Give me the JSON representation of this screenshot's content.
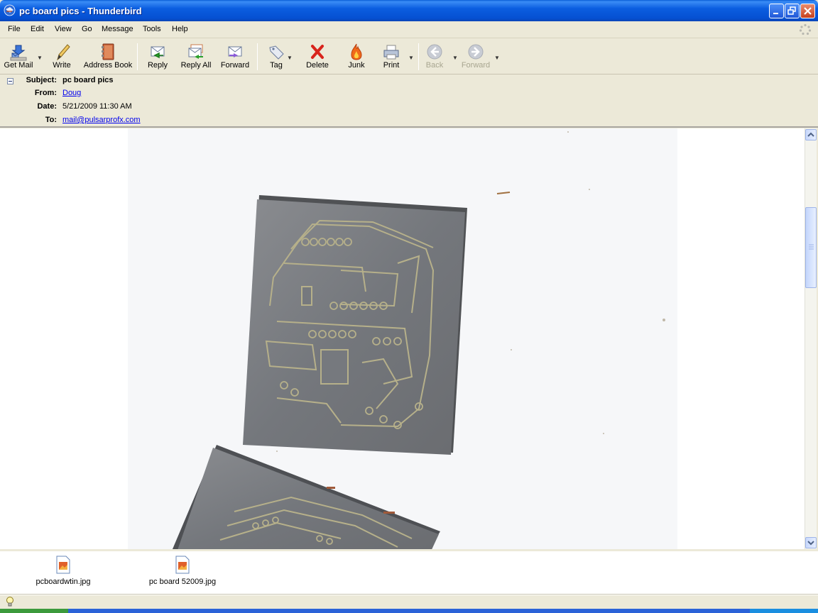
{
  "window": {
    "title": "pc board pics - Thunderbird",
    "icon": "thunderbird-icon"
  },
  "menu": {
    "items": [
      "File",
      "Edit",
      "View",
      "Go",
      "Message",
      "Tools",
      "Help"
    ]
  },
  "toolbar": {
    "buttons": [
      {
        "label": "Get Mail",
        "icon": "get-mail-icon"
      },
      {
        "label": "Write",
        "icon": "write-pencil-icon"
      },
      {
        "label": "Address Book",
        "icon": "address-book-icon"
      },
      {
        "label": "Reply",
        "icon": "reply-icon"
      },
      {
        "label": "Reply All",
        "icon": "reply-all-icon"
      },
      {
        "label": "Forward",
        "icon": "forward-icon"
      },
      {
        "label": "Tag",
        "icon": "tag-icon"
      },
      {
        "label": "Delete",
        "icon": "delete-x-icon"
      },
      {
        "label": "Junk",
        "icon": "junk-flame-icon"
      },
      {
        "label": "Print",
        "icon": "printer-icon"
      },
      {
        "label": "Back",
        "icon": "back-arrow-icon",
        "disabled": true
      },
      {
        "label": "Forward",
        "icon": "forward-arrow-icon",
        "disabled": true
      }
    ]
  },
  "header": {
    "subject_label": "Subject:",
    "subject": "pc board pics",
    "from_label": "From:",
    "from": "Doug",
    "date_label": "Date:",
    "date": "5/21/2009 11:30 AM",
    "to_label": "To:",
    "to": "mail@pulsarprofx.com"
  },
  "body": {
    "image": "scanned-pc-boards-photo"
  },
  "attachments": [
    {
      "name": "pcboardwtin.jpg",
      "icon": "jpg-file-icon"
    },
    {
      "name": "pc board 52009.jpg",
      "icon": "jpg-file-icon"
    }
  ],
  "colors": {
    "titlebar": "#0550d2",
    "chrome": "#ece9d8",
    "link": "#0000ee",
    "board": "#7a7d80",
    "trace": "#b6b08a"
  }
}
